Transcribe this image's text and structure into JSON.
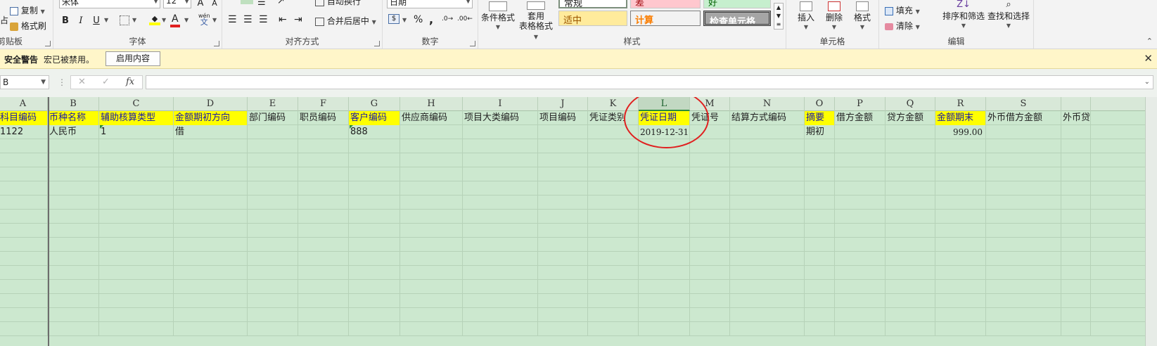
{
  "ribbon": {
    "clipboard": {
      "label": "剪贴板",
      "paste_partial": "占",
      "copy_label": "复制",
      "format_painter_label": "格式刷"
    },
    "font": {
      "label": "字体",
      "font_name": "宋体",
      "font_size": "12",
      "bold": "B",
      "italic": "I",
      "underline": "U",
      "grow": "A",
      "shrink": "A",
      "phonetic": "wén",
      "phonetic_char": "文",
      "font_color_char": "A"
    },
    "alignment": {
      "label": "对齐方式",
      "wrap_label": "自动换行",
      "merge_label": "合并后居中"
    },
    "number": {
      "label": "数字",
      "format": "日期",
      "percent": "%",
      "comma": ","
    },
    "styles": {
      "label": "样式",
      "cond_format_label": "条件格式",
      "table_format_label_1": "套用",
      "table_format_label_2": "表格格式",
      "cell_normal": "常规",
      "cell_bad": "差",
      "cell_good": "好",
      "cell_neutral": "适中",
      "cell_calc": "计算",
      "cell_check": "检查单元格"
    },
    "cells": {
      "label": "单元格",
      "insert_label": "插入",
      "delete_label": "删除",
      "format_label": "格式"
    },
    "editing": {
      "label": "编辑",
      "fill_label": "填充",
      "clear_label": "清除",
      "sort_label": "排序和筛选",
      "find_label": "查找和选择"
    }
  },
  "security_bar": {
    "title": "安全警告",
    "message": "宏已被禁用。",
    "enable_button": "启用内容"
  },
  "formula_bar": {
    "name_box": "B",
    "fx": "fx",
    "cancel": "✕",
    "confirm": "✓",
    "formula": ""
  },
  "sheet": {
    "columns": [
      "A",
      "B",
      "C",
      "D",
      "E",
      "F",
      "G",
      "H",
      "I",
      "J",
      "K",
      "L",
      "M",
      "N",
      "O",
      "P",
      "Q",
      "R",
      "S",
      ""
    ],
    "selected_column": "L",
    "header_row": [
      "科目编码",
      "币种名称",
      "辅助核算类型",
      "金额期初方向",
      "部门编码",
      "职员编码",
      "客户编码",
      "供应商编码",
      "项目大类编码",
      "项目编码",
      "凭证类别",
      "凭证日期",
      "凭证号",
      "结算方式编码",
      "摘要",
      "借方金额",
      "贷方金额",
      "金额期末",
      "外币借方金额",
      "外币贷"
    ],
    "data_row": [
      "1122",
      "人民币",
      "1",
      "借",
      "",
      "",
      "888",
      "",
      "",
      "",
      "",
      "2019-12-31",
      "",
      "",
      "期初",
      "",
      "",
      "999.00",
      "",
      ""
    ]
  },
  "colors": {
    "grid_bg": "#cce8cf",
    "highlight": "#ffff00",
    "circle": "#e02020"
  }
}
